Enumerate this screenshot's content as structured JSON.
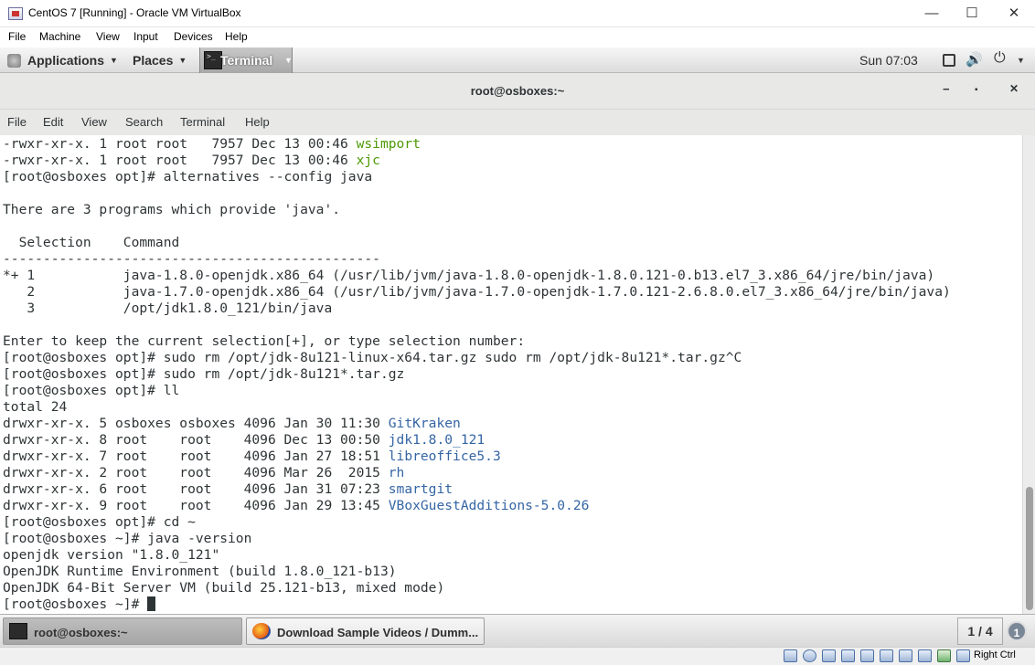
{
  "vbox": {
    "window_title": "CentOS 7 [Running] - Oracle VM VirtualBox",
    "controls": {
      "minimize": "—",
      "maximize": "☐",
      "close": "✕"
    },
    "menu": [
      "File",
      "Machine",
      "View",
      "Input",
      "Devices",
      "Help"
    ],
    "host_key": "Right Ctrl"
  },
  "gnome": {
    "applications": "Applications",
    "places": "Places",
    "terminal": "Terminal",
    "clock": "Sun 07:03",
    "caret": "▼"
  },
  "terminal": {
    "title": "root@osboxes:~",
    "controls": {
      "minimize": "−",
      "maximize": "▪",
      "close": "✕"
    },
    "menu": [
      "File",
      "Edit",
      "View",
      "Search",
      "Terminal",
      "Help"
    ],
    "lines": [
      {
        "text": "-rwxr-xr-x. 1 root root   7957 Dec 13 00:46 ",
        "hl": "wsimport",
        "hl_class": "hl-green"
      },
      {
        "text": "-rwxr-xr-x. 1 root root   7957 Dec 13 00:46 ",
        "hl": "xjc",
        "hl_class": "hl-green"
      },
      {
        "text": "[root@osboxes opt]# alternatives --config java",
        "hl": "",
        "hl_class": ""
      },
      {
        "text": "",
        "hl": "",
        "hl_class": ""
      },
      {
        "text": "There are 3 programs which provide 'java'.",
        "hl": "",
        "hl_class": ""
      },
      {
        "text": "",
        "hl": "",
        "hl_class": ""
      },
      {
        "text": "  Selection    Command",
        "hl": "",
        "hl_class": ""
      },
      {
        "text": "-----------------------------------------------",
        "hl": "",
        "hl_class": ""
      },
      {
        "text": "*+ 1           java-1.8.0-openjdk.x86_64 (/usr/lib/jvm/java-1.8.0-openjdk-1.8.0.121-0.b13.el7_3.x86_64/jre/bin/java)",
        "hl": "",
        "hl_class": ""
      },
      {
        "text": "   2           java-1.7.0-openjdk.x86_64 (/usr/lib/jvm/java-1.7.0-openjdk-1.7.0.121-2.6.8.0.el7_3.x86_64/jre/bin/java)",
        "hl": "",
        "hl_class": ""
      },
      {
        "text": "   3           /opt/jdk1.8.0_121/bin/java",
        "hl": "",
        "hl_class": ""
      },
      {
        "text": "",
        "hl": "",
        "hl_class": ""
      },
      {
        "text": "Enter to keep the current selection[+], or type selection number:",
        "hl": "",
        "hl_class": ""
      },
      {
        "text": "[root@osboxes opt]# sudo rm /opt/jdk-8u121-linux-x64.tar.gz sudo rm /opt/jdk-8u121*.tar.gz^C",
        "hl": "",
        "hl_class": ""
      },
      {
        "text": "[root@osboxes opt]# sudo rm /opt/jdk-8u121*.tar.gz",
        "hl": "",
        "hl_class": ""
      },
      {
        "text": "[root@osboxes opt]# ll",
        "hl": "",
        "hl_class": ""
      },
      {
        "text": "total 24",
        "hl": "",
        "hl_class": ""
      },
      {
        "text": "drwxr-xr-x. 5 osboxes osboxes 4096 Jan 30 11:30 ",
        "hl": "GitKraken",
        "hl_class": "hl-blue"
      },
      {
        "text": "drwxr-xr-x. 8 root    root    4096 Dec 13 00:50 ",
        "hl": "jdk1.8.0_121",
        "hl_class": "hl-blue"
      },
      {
        "text": "drwxr-xr-x. 7 root    root    4096 Jan 27 18:51 ",
        "hl": "libreoffice5.3",
        "hl_class": "hl-blue"
      },
      {
        "text": "drwxr-xr-x. 2 root    root    4096 Mar 26  2015 ",
        "hl": "rh",
        "hl_class": "hl-blue"
      },
      {
        "text": "drwxr-xr-x. 6 root    root    4096 Jan 31 07:23 ",
        "hl": "smartgit",
        "hl_class": "hl-blue"
      },
      {
        "text": "drwxr-xr-x. 9 root    root    4096 Jan 29 13:45 ",
        "hl": "VBoxGuestAdditions-5.0.26",
        "hl_class": "hl-blue"
      },
      {
        "text": "[root@osboxes opt]# cd ~",
        "hl": "",
        "hl_class": ""
      },
      {
        "text": "[root@osboxes ~]# java -version",
        "hl": "",
        "hl_class": ""
      },
      {
        "text": "openjdk version \"1.8.0_121\"",
        "hl": "",
        "hl_class": ""
      },
      {
        "text": "OpenJDK Runtime Environment (build 1.8.0_121-b13)",
        "hl": "",
        "hl_class": ""
      },
      {
        "text": "OpenJDK 64-Bit Server VM (build 25.121-b13, mixed mode)",
        "hl": "",
        "hl_class": ""
      },
      {
        "text": "[root@osboxes ~]# ",
        "hl": "",
        "hl_class": "",
        "cursor": true
      }
    ]
  },
  "taskbar": {
    "terminal_task": "root@osboxes:~",
    "firefox_task": "Download Sample Videos / Dumm...",
    "workspace": "1 / 4",
    "notifications": "1"
  }
}
